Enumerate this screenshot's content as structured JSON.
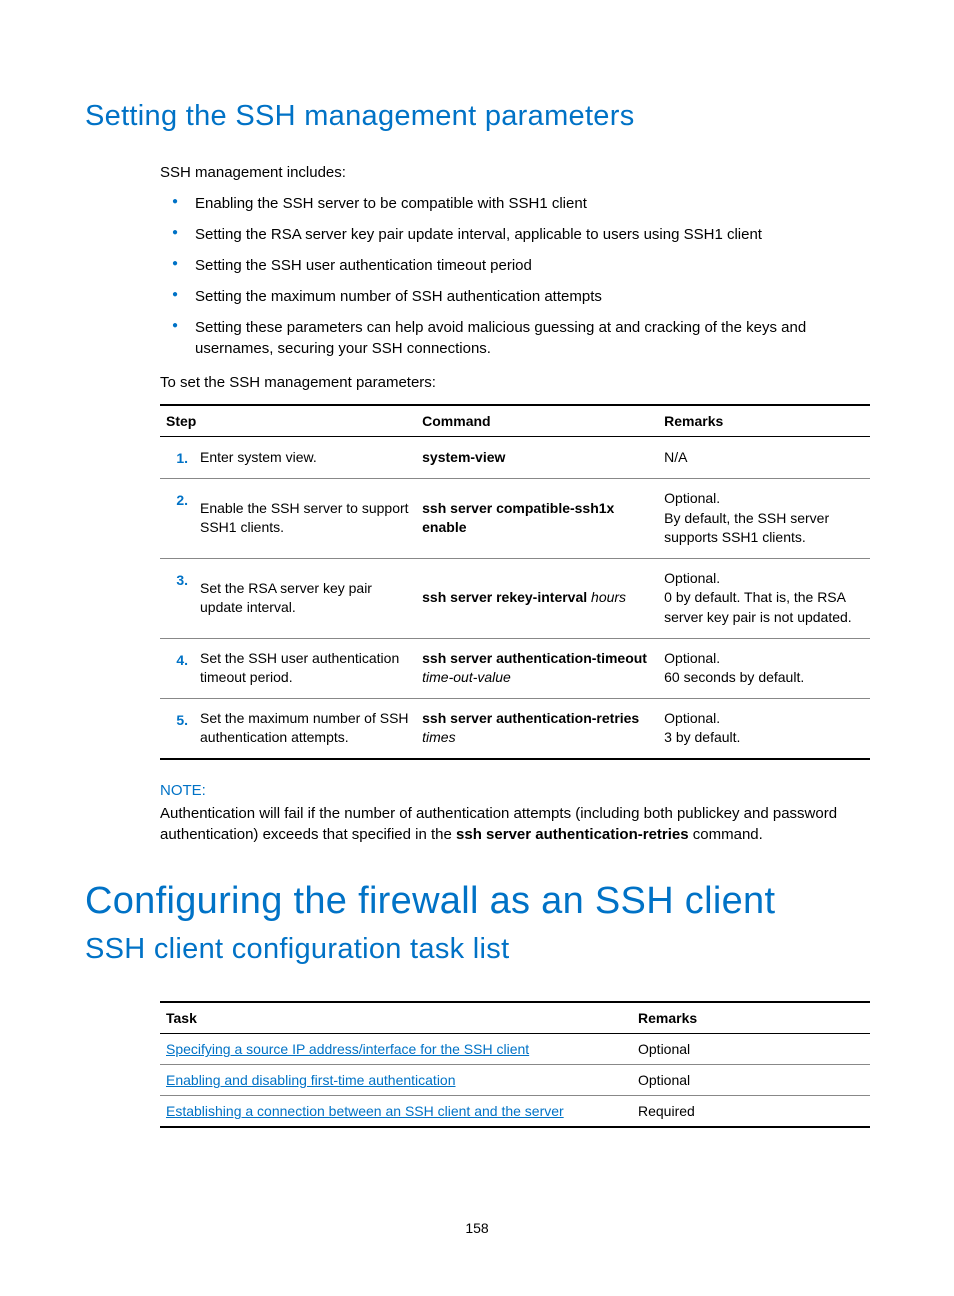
{
  "section_heading": "Setting the SSH management parameters",
  "intro": "SSH management includes:",
  "bullets": [
    "Enabling the SSH server to be compatible with SSH1 client",
    "Setting the RSA server key pair update interval, applicable to users using SSH1 client",
    "Setting the SSH user authentication timeout period",
    "Setting the maximum number of SSH authentication attempts",
    "Setting these parameters can help avoid malicious guessing at and cracking of the keys and usernames, securing your SSH connections."
  ],
  "pre_table_text": "To set the SSH management parameters:",
  "table1": {
    "headers": {
      "step": "Step",
      "command": "Command",
      "remarks": "Remarks"
    },
    "rows": [
      {
        "num": "1.",
        "step": "Enter system view.",
        "command_html": "<b>system-view</b>",
        "remarks_html": "N/A"
      },
      {
        "num": "2.",
        "step": "Enable the SSH server to support SSH1 clients.",
        "command_html": "<b>ssh server compatible-ssh1x enable</b>",
        "remarks_html": "Optional.<br>By default, the SSH server supports SSH1 clients."
      },
      {
        "num": "3.",
        "step": "Set the RSA server key pair update interval.",
        "command_html": "<b>ssh server rekey-interval</b> <i>hours</i>",
        "remarks_html": "Optional.<br>0 by default. That is, the RSA server key pair is not updated."
      },
      {
        "num": "4.",
        "step": "Set the SSH user authentication timeout period.",
        "command_html": "<b>ssh server authentication-timeout</b> <i>time-out-value</i>",
        "remarks_html": "Optional.<br>60 seconds by default."
      },
      {
        "num": "5.",
        "step": "Set the maximum number of SSH authentication attempts.",
        "command_html": "<b>ssh server authentication-retries</b> <i>times</i>",
        "remarks_html": "Optional.<br>3 by default."
      }
    ]
  },
  "note": {
    "label": "NOTE:",
    "text_html": "Authentication will fail if the number of authentication attempts (including both publickey and password authentication) exceeds that specified in the <b>ssh server authentication-retries</b> command."
  },
  "chapter_heading": "Configuring the firewall as an SSH client",
  "subsection_heading": "SSH client configuration task list",
  "table2": {
    "headers": {
      "task": "Task",
      "remarks": "Remarks"
    },
    "rows": [
      {
        "task": "Specifying a source IP address/interface for the SSH client",
        "remarks": "Optional"
      },
      {
        "task": "Enabling and disabling first-time authentication",
        "remarks": "Optional"
      },
      {
        "task": "Establishing a connection between an SSH client and the server",
        "remarks": "Required"
      }
    ]
  },
  "page_number": "158"
}
